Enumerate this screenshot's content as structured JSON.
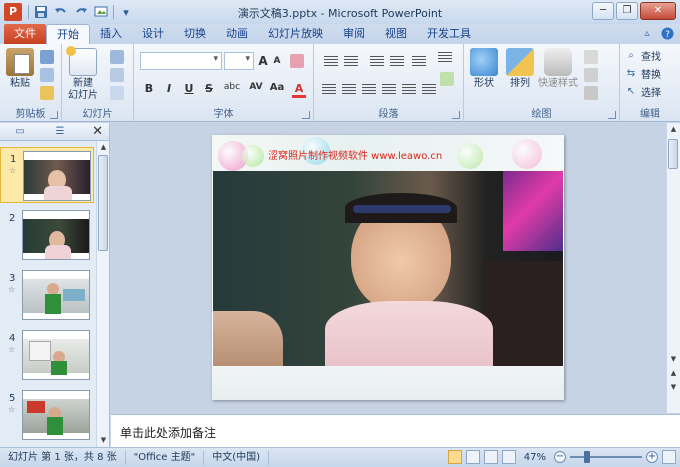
{
  "app": {
    "logo_letter": "P",
    "title": "演示文稿3.pptx  -  Microsoft PowerPoint"
  },
  "quick_access": {
    "icons": [
      "save-icon",
      "undo-icon",
      "redo-icon",
      "slideshow-icon",
      "customize-icon"
    ]
  },
  "window": {
    "minimize": "─",
    "restore": "❐",
    "close": "✕"
  },
  "tabs": [
    "文件",
    "开始",
    "插入",
    "设计",
    "切换",
    "动画",
    "幻灯片放映",
    "审阅",
    "视图",
    "开发工具"
  ],
  "active_tab_index": 1,
  "ribbon": {
    "clipboard": {
      "label": "剪贴板",
      "paste": "粘贴"
    },
    "slides": {
      "label": "幻灯片",
      "new_slide_line1": "新建",
      "new_slide_line2": "幻灯片"
    },
    "font": {
      "label": "字体",
      "bold": "B",
      "italic": "I",
      "underline": "U",
      "strike": "S",
      "shadow": "abc",
      "spacing": "AV",
      "case": "Aa",
      "color": "A",
      "grow": "A",
      "shrink": "A"
    },
    "paragraph": {
      "label": "段落"
    },
    "drawing": {
      "label": "绘图",
      "shapes": "形状",
      "arrange": "排列",
      "quick_styles": "快速样式"
    },
    "editing": {
      "label": "编辑",
      "find": "查找",
      "replace": "替换",
      "select": "选择"
    }
  },
  "slide_panel": {
    "tab_slides_icon": "slides-view-icon",
    "tab_outline_icon": "outline-view-icon",
    "close": "✕",
    "thumbnails": [
      {
        "num": "1",
        "star": "☆",
        "selected": true
      },
      {
        "num": "2",
        "star": "",
        "selected": false
      },
      {
        "num": "3",
        "star": "☆",
        "selected": false
      },
      {
        "num": "4",
        "star": "☆",
        "selected": false
      },
      {
        "num": "5",
        "star": "☆",
        "selected": false
      }
    ]
  },
  "slide": {
    "caption": "涩窝照片制作视频软件 www.leawo.cn"
  },
  "notes": {
    "placeholder": "单击此处添加备注"
  },
  "status": {
    "slide_info": "幻灯片 第 1 张，共 8 张",
    "theme": "\"Office 主题\"",
    "language": "中文(中国)",
    "zoom": "47%",
    "zoom_level": 0.47
  },
  "colors": {
    "accent": "#d24726",
    "ribbon_text": "#15428b",
    "caption": "#d9261c"
  }
}
